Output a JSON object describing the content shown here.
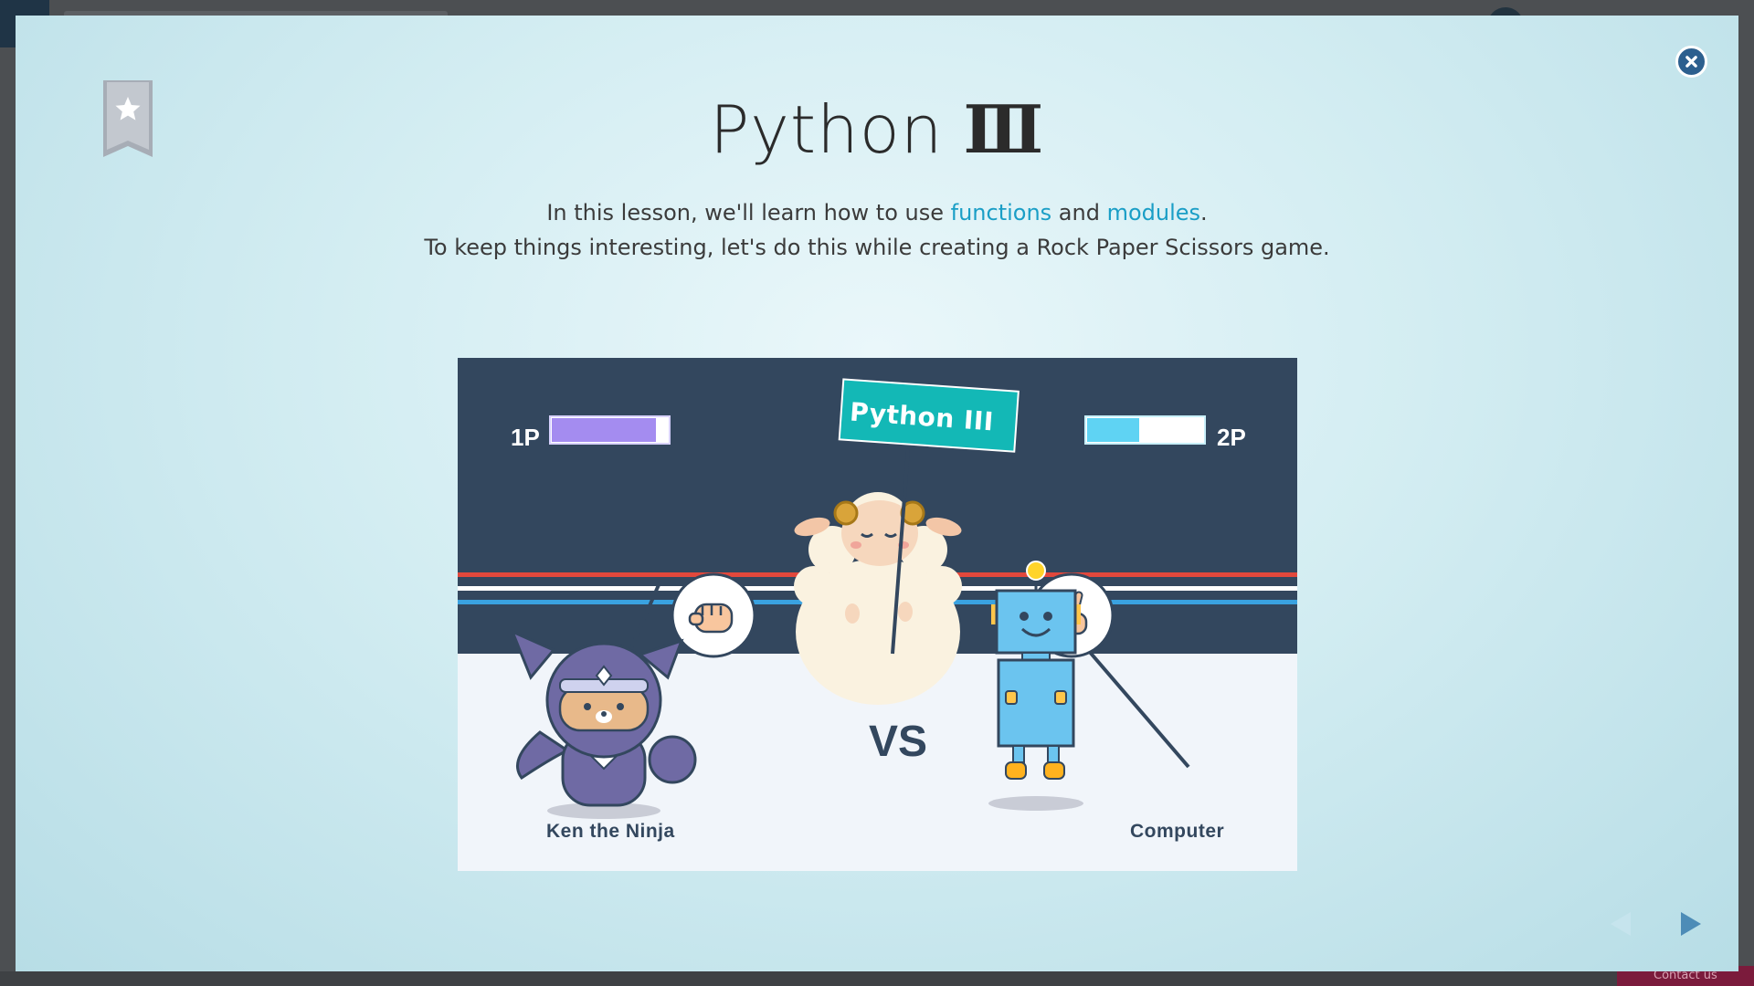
{
  "background": {
    "contact_label": "Contact us"
  },
  "modal": {
    "title_word": "Python",
    "title_numeral": "Ⅲ",
    "description": {
      "line1_prefix": "In this lesson, we'll learn how to use ",
      "link_functions": "functions",
      "line1_middle": " and ",
      "link_modules": "modules",
      "line1_suffix": ".",
      "line2": "To keep things interesting, let's do this while creating a Rock Paper Scissors game."
    },
    "illustration": {
      "player1_label": "1P",
      "player2_label": "2P",
      "sign_text": "Python III",
      "vs_text": "VS",
      "player1_name": "Ken the Ninja",
      "player2_name": "Computer",
      "player1_health": 0.9,
      "player2_health": 0.45,
      "player1_hand": "rock-hand-icon",
      "player2_hand": "scissors-hand-icon"
    },
    "icons": {
      "close": "close-icon",
      "bookmark": "bookmark-star-icon",
      "prev": "previous-arrow-icon",
      "next": "next-arrow-icon"
    },
    "colors": {
      "accent_link": "#1a9ec6",
      "close_button": "#2c5f8e",
      "scene_dark": "#33475e",
      "player1_bar": "#a48cf0",
      "player2_bar": "#5fd3f3",
      "sign": "#13b8b6"
    }
  }
}
